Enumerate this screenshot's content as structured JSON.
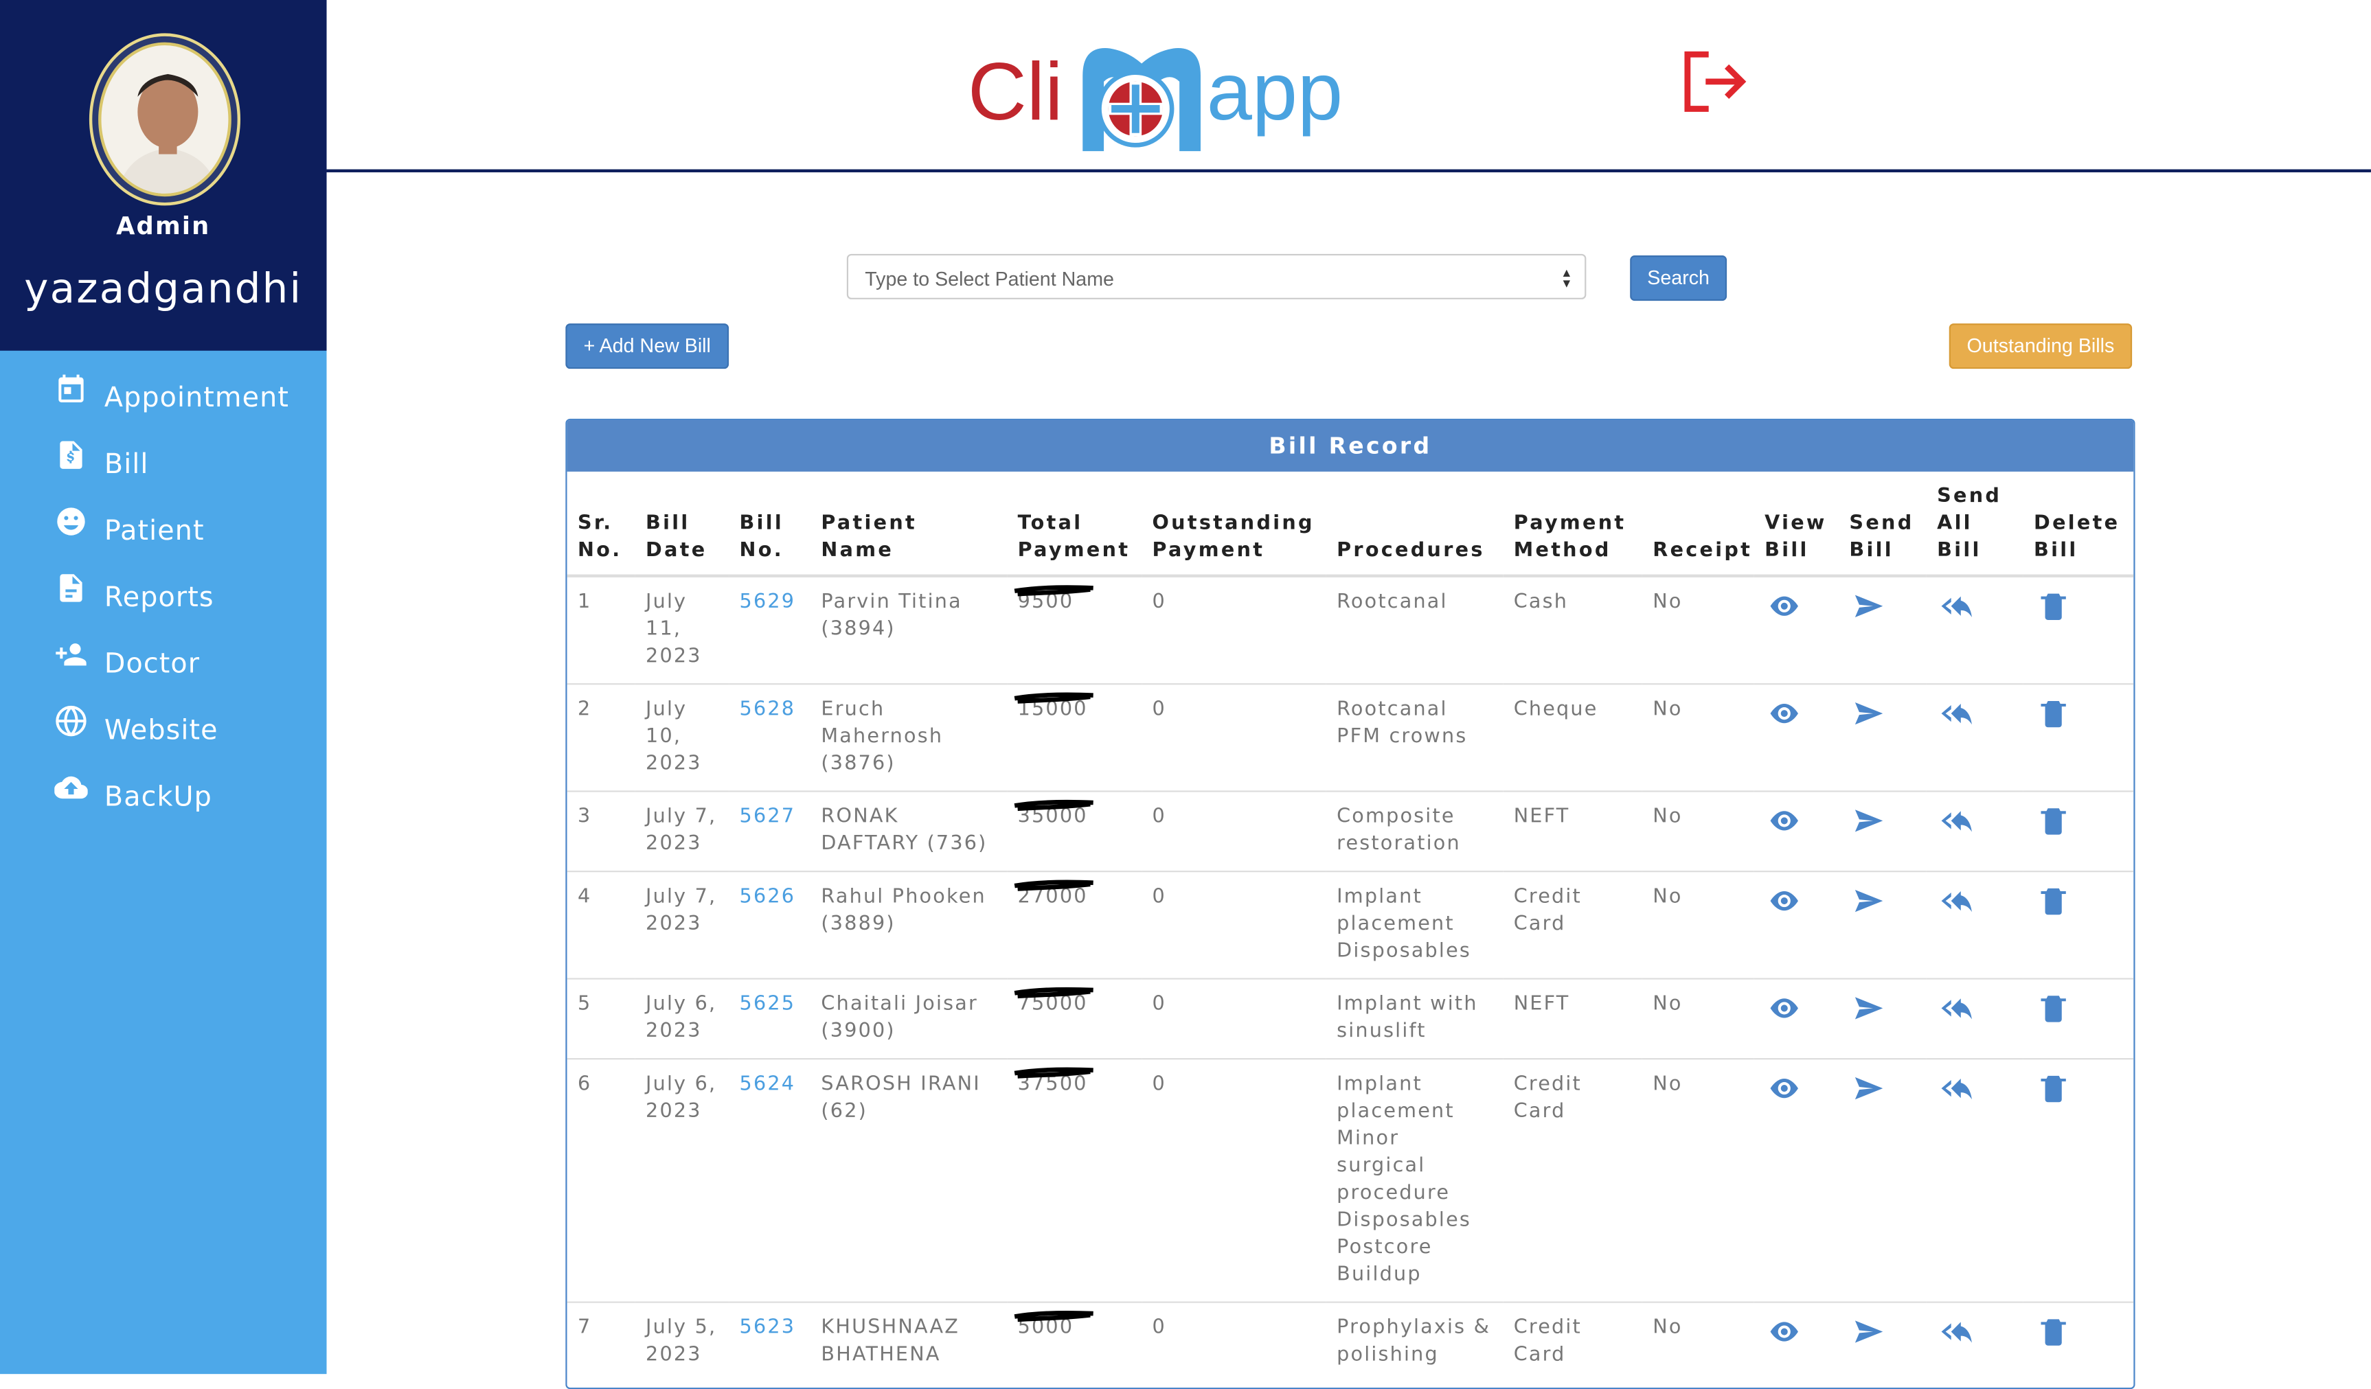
{
  "sidebar": {
    "role": "Admin",
    "username": "yazadgandhi",
    "items": [
      {
        "label": "Appointment",
        "icon": "calendar-icon"
      },
      {
        "label": "Bill",
        "icon": "invoice-icon"
      },
      {
        "label": "Patient",
        "icon": "patient-face-icon"
      },
      {
        "label": "Reports",
        "icon": "report-icon"
      },
      {
        "label": "Doctor",
        "icon": "add-person-icon"
      },
      {
        "label": "Website",
        "icon": "globe-icon"
      },
      {
        "label": "BackUp",
        "icon": "cloud-upload-icon"
      }
    ]
  },
  "header": {
    "logo_part1": "Cli",
    "logo_part2": "app",
    "logout_icon": "logout-icon",
    "brand_colors": {
      "red": "#c0262d",
      "blue": "#4aa3e0",
      "navy": "#0d1e5c"
    }
  },
  "toolbar": {
    "patient_placeholder": "Type to Select Patient Name",
    "search_label": "Search",
    "add_bill_label": "+ Add New Bill",
    "outstanding_label": "Outstanding Bills"
  },
  "bill_record": {
    "title": "Bill Record",
    "columns": [
      [
        "Sr.",
        "No."
      ],
      [
        "Bill",
        "Date"
      ],
      [
        "Bill",
        "No."
      ],
      [
        "Patient Name"
      ],
      [
        "Total",
        "Payment"
      ],
      [
        "Outstanding",
        "Payment"
      ],
      [
        "Procedures"
      ],
      [
        "Payment",
        "Method"
      ],
      [
        "Receipt"
      ],
      [
        "View",
        "Bill"
      ],
      [
        "Send",
        "Bill"
      ],
      [
        "Send",
        "All",
        "Bill"
      ],
      [
        "Delete",
        "Bill"
      ]
    ],
    "rows": [
      {
        "sr": "1",
        "date": "July 11, 2023",
        "bill_no": "5629",
        "patient": "Parvin Titina (3894)",
        "total": "9500",
        "outstanding": "0",
        "procedures": "Rootcanal",
        "method": "Cash",
        "receipt": "No"
      },
      {
        "sr": "2",
        "date": "July 10, 2023",
        "bill_no": "5628",
        "patient": "Eruch Mahernosh (3876)",
        "total": "15000",
        "outstanding": "0",
        "procedures": "Rootcanal PFM crowns",
        "method": "Cheque",
        "receipt": "No"
      },
      {
        "sr": "3",
        "date": "July 7, 2023",
        "bill_no": "5627",
        "patient": "RONAK DAFTARY (736)",
        "total": "35000",
        "outstanding": "0",
        "procedures": "Composite restoration",
        "method": "NEFT",
        "receipt": "No"
      },
      {
        "sr": "4",
        "date": "July 7, 2023",
        "bill_no": "5626",
        "patient": "Rahul Phooken (3889)",
        "total": "27000",
        "outstanding": "0",
        "procedures": "Implant placement Disposables",
        "method": "Credit Card",
        "receipt": "No"
      },
      {
        "sr": "5",
        "date": "July 6, 2023",
        "bill_no": "5625",
        "patient": "Chaitali Joisar (3900)",
        "total": "75000",
        "outstanding": "0",
        "procedures": "Implant with sinuslift",
        "method": "NEFT",
        "receipt": "No"
      },
      {
        "sr": "6",
        "date": "July 6, 2023",
        "bill_no": "5624",
        "patient": "SAROSH IRANI (62)",
        "total": "37500",
        "outstanding": "0",
        "procedures": "Implant placement Minor surgical procedure Disposables Postcore Buildup",
        "method": "Credit Card",
        "receipt": "No"
      },
      {
        "sr": "7",
        "date": "July 5, 2023",
        "bill_no": "5623",
        "patient": "KHUSHNAAZ BHATHENA",
        "total": "5000",
        "outstanding": "0",
        "procedures": "Prophylaxis & polishing",
        "method": "Credit Card",
        "receipt": "No"
      }
    ],
    "action_icons": [
      "eye-icon",
      "send-icon",
      "reply-all-icon",
      "trash-icon"
    ],
    "accent_color": "#4a85c9"
  }
}
